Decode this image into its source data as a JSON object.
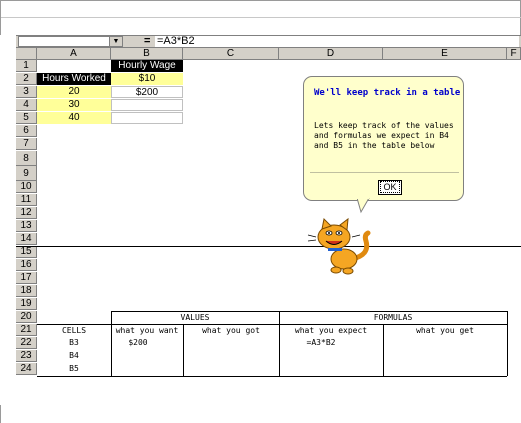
{
  "formula_bar": {
    "name_box": "",
    "equals": "=",
    "formula": "=A3*B2"
  },
  "columns": [
    "A",
    "B",
    "C",
    "D",
    "E",
    "F"
  ],
  "rows": [
    "1",
    "2",
    "3",
    "4",
    "5",
    "6",
    "7",
    "8",
    "9",
    "10",
    "11",
    "12",
    "13",
    "14",
    "15",
    "16",
    "17",
    "18",
    "19",
    "20",
    "21",
    "22",
    "23",
    "24"
  ],
  "cells": {
    "B1": "Hourly Wage",
    "A2": "Hours Worked",
    "B2": "$10",
    "A3": "20",
    "B3": "$200",
    "A4": "30",
    "A5": "40"
  },
  "tracking_table": {
    "values_header": "VALUES",
    "formulas_header": "FORMULAS",
    "cells_header": "CELLS",
    "want_header": "what you want",
    "got_header": "what you got",
    "expect_header": "what you expect",
    "get_header": "what you get",
    "rows": [
      {
        "cell": "B3",
        "want": "$200",
        "expect": "=A3*B2"
      },
      {
        "cell": "B4",
        "want": "",
        "expect": ""
      },
      {
        "cell": "B5",
        "want": "",
        "expect": ""
      }
    ]
  },
  "assistant_bubble": {
    "title": "We'll keep track in a table",
    "body": "Lets keep track of the values and formulas we expect in B4 and B5 in the table below",
    "ok_label": "OK"
  },
  "icons": [
    "dropdown-arrow-icon",
    "office-assistant-cat-icon"
  ]
}
